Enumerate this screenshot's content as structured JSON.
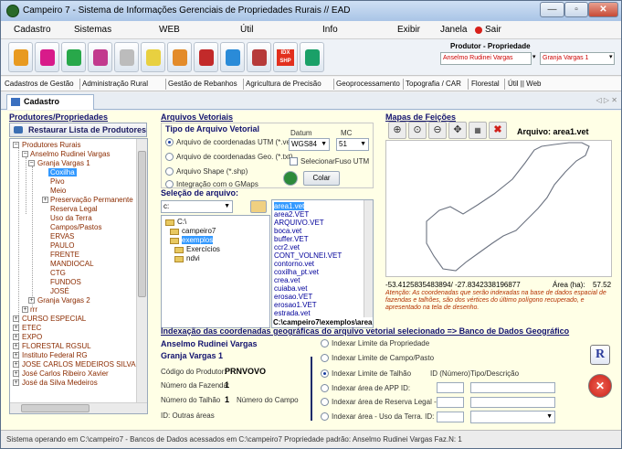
{
  "window": {
    "title": "Campeiro 7 - Sistema de Informações Gerenciais de Propriedades Rurais // EAD",
    "controls": {
      "minimize": "—",
      "maximize": "▫",
      "close": "✕"
    }
  },
  "menubar": {
    "items": [
      "Cadastro",
      "Sistemas",
      "WEB",
      "Útil",
      "Info",
      "Exibir",
      "Janela",
      "Sair"
    ]
  },
  "toolbar": {
    "produtor_label": "Produtor - Propriedade",
    "produtor_value": "Anselmo Rudinei Vargas",
    "propriedade_value": "Granja Vargas 1",
    "idx_label": "IDX",
    "shp_label": "SHP"
  },
  "module_tabs": [
    "Cadastros de Gestão",
    "Administração Rural",
    "Gestão de Rebanhos",
    "Agricultura de Precisão",
    "Geoprocessamento",
    "Topografia / CAR",
    "Florestal",
    "Útil || Web"
  ],
  "doc_tab": {
    "label": "Cadastro Espacial",
    "nav": "◁ ▷ ✕"
  },
  "left": {
    "header": "Produtores/Propriedades",
    "restore_button": "Restaurar Lista de Produtores",
    "tree": {
      "root": "Produtores Rurais",
      "producer": "Anselmo Rudinei Vargas",
      "property": "Granja Vargas 1",
      "fields": [
        "Coxilha",
        "Pivo",
        "Meio",
        "Preservação Permanente",
        "Reserva Legal",
        "Uso da Terra",
        "Campos/Pastos",
        "ERVAS",
        "PAULO",
        "FRENTE",
        "MANDIOCAL",
        "CTG",
        "FUNDOS",
        "JOSÉ"
      ],
      "property2": "Granja Vargas 2",
      "rrr": "rrr",
      "others": [
        "CURSO ESPECIAL",
        "ETEC",
        "EXPO",
        "FLORESTAL RGSUL",
        "Instituto Federal RG",
        "JOSE CARLOS MEDEIROS SILVA",
        "José Carlos Ribeiro Xavier",
        "José da Silva Medeiros"
      ]
    }
  },
  "vetoriais": {
    "header": "Arquivos Vetoriais",
    "tipo_header": "Tipo de Arquivo Vetorial",
    "options": [
      "Arquivo de coordenadas UTM (*.vet)",
      "Arquivo de coordenadas Geo. (*.txt)",
      "Arquivo Shape (*.shp)",
      "Integração com o GMaps"
    ],
    "datum_label": "Datum",
    "datum_value": "WGS84",
    "mc_label": "MC",
    "mc_value": "51",
    "fuso_label": "SelecionarFuso UTM",
    "colar_label": "Colar",
    "selecao_label": "Seleção de arquivo:",
    "drive": "c:",
    "dirs": [
      "C:\\",
      "campeiro7",
      "exemplos",
      "Exercícios",
      "ndvi"
    ],
    "files": [
      "area1.vet",
      "area2.VET",
      "ARQUIVO.VET",
      "boca.vet",
      "buffer.VET",
      "ccr2.vet",
      "CONT_VOLNEI.VET",
      "contorno.vet",
      "coxilha_pt.vet",
      "crea.vet",
      "cuiaba.vet",
      "erosao.VET",
      "erosao1.VET",
      "estrada.vet"
    ],
    "path": "C:\\campeiro7\\exemplos\\area"
  },
  "mapas": {
    "header": "Mapas de Feições",
    "arquivo": "Arquivo: area1.vet",
    "coords": "-53.4125835483894/ -27.8342338196877",
    "area_label": "Área (ha):",
    "area_value": "57.52",
    "note": "Atenção: As coordenadas que serão indexadas na base de dados espacial de fazendas e talhões, são dos vértices do último polígono recuperado, e apresentado na tela de desenho."
  },
  "indexacao": {
    "header": "Indexação das coordenadas geográficas do arquivo vetorial selecionado => Banco de Dados Geográfico",
    "produtor": "Anselmo Rudinei Vargas",
    "propriedade": "Granja Vargas 1",
    "cod_label": "Código do Produtor:",
    "cod_value": "PRNVOVO",
    "fazenda_label": "Número da Fazenda:",
    "fazenda_value": "1",
    "talhao_label": "Número do Talhão",
    "talhao_value": "1",
    "campo_label": "Número do Campo",
    "id_label": "ID: Outras áreas",
    "options": [
      "Indexar Limite da Propriedade",
      "Indexar Limite de Campo/Pasto",
      "Indexar Limite de Talhão",
      "Indexar área de APP  ID:",
      "Indexar área de Reserva Legal - ID",
      "Indexar área - Uso da Terra. ID:"
    ],
    "id_numero_label": "ID (Número)",
    "tipo_descricao_label": "Tipo/Descrição",
    "r_label": "R",
    "x_label": "✕"
  },
  "status": {
    "text": "Sistema operando em C:\\campeiro7  -  Bancos de Dados acessados em C:\\campeiro7  Propriedade padrão: Anselmo Rudinei Vargas Faz.N: 1"
  },
  "colors": {
    "content_bg": "#ffffe6",
    "header_blue": "#12126e",
    "tree_text": "#8b2b00",
    "selection": "#3399ff",
    "note_text": "#b33000"
  }
}
